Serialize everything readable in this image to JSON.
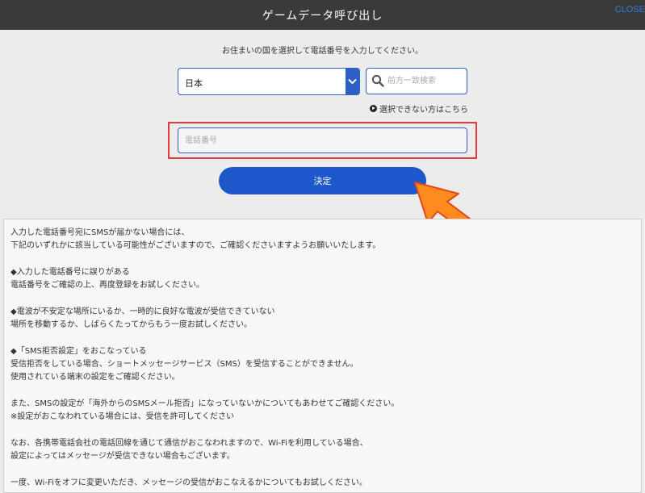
{
  "header": {
    "title": "ゲームデータ呼び出し",
    "close_label": "CLOSE"
  },
  "instruction": "お住まいの国を選択して電話番号を入力してください。",
  "country_select": {
    "value": "日本"
  },
  "search": {
    "placeholder": "前方一致検索"
  },
  "help_link": "選択できない方はこちら",
  "phone": {
    "placeholder": "電話番号",
    "value": ""
  },
  "submit_label": "決定",
  "colors": {
    "accent": "#1e57c9",
    "highlight": "#e53a3a",
    "arrow": "#ff8a1f",
    "header": "#3a3a3a"
  },
  "notice": {
    "lines": [
      "入力した電話番号宛にSMSが届かない場合には、",
      "下記のいずれかに該当している可能性がございますので、ご確認くださいますようお願いいたします。",
      "",
      "◆入力した電話番号に誤りがある",
      "電話番号をご確認の上、再度登録をお試しください。",
      "",
      "◆電波が不安定な場所にいるか、一時的に良好な電波が受信できていない",
      "場所を移動するか、しばらくたってからもう一度お試しください。",
      "",
      "◆「SMS拒否設定」をおこなっている",
      "受信拒否をしている場合、ショートメッセージサービス（SMS）を受信することができません。",
      "使用されている端末の設定をご確認ください。",
      "",
      "また、SMSの設定が「海外からのSMSメール拒否」になっていないかについてもあわせてご確認ください。",
      "※設定がおこなわれている場合には、受信を許可してください",
      "",
      "なお、各携帯電話会社の電話回線を通じて通信がおこなわれますので、Wi-Fiを利用している場合、",
      "設定によってはメッセージが受信できない場合もございます。",
      "",
      "一度、Wi-Fiをオフに変更いただき、メッセージの受信がおこなえるかについてもお試しください。"
    ]
  }
}
